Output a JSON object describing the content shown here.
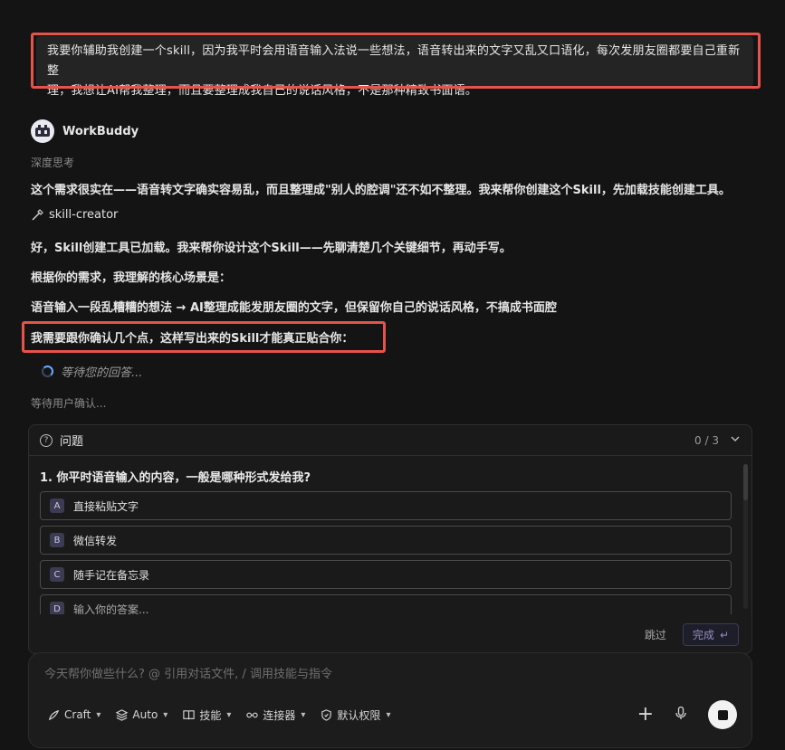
{
  "user_message": {
    "line1": "我要你辅助我创建一个skill，因为我平时会用语音输入法说一些想法，语音转出来的文字又乱又口语化，每次发朋友圈都要自己重新整",
    "line2": "理，我想让AI帮我整理，而且要整理成我自己的说话风格，不是那种精致书面语。"
  },
  "agent": {
    "name": "WorkBuddy",
    "thinking_label": "深度思考",
    "lines": [
      "这个需求很实在——语音转文字确实容易乱，而且整理成\"别人的腔调\"还不如不整理。我来帮你创建这个Skill，先加载技能创建工具。",
      "好，Skill创建工具已加载。我来帮你设计这个Skill——先聊清楚几个关键细节，再动手写。",
      "根据你的需求，我理解的核心场景是：",
      "语音输入一段乱糟糟的想法 → AI整理成能发朋友圈的文字，但保留你自己的说话风格，不搞成书面腔",
      "我需要跟你确认几个点，这样写出来的Skill才能真正贴合你："
    ],
    "skill_tool": "skill-creator",
    "waiting_answer": "等待您的回答...",
    "waiting_confirm": "等待用户确认..."
  },
  "question_card": {
    "title": "问题",
    "count": "0 / 3",
    "question": "1. 你平时语音输入的内容，一般是哪种形式发给我?",
    "options": [
      {
        "key": "A",
        "label": "直接粘贴文字"
      },
      {
        "key": "B",
        "label": "微信转发"
      },
      {
        "key": "C",
        "label": "随手记在备忘录"
      },
      {
        "key": "D",
        "label": "输入你的答案..."
      }
    ],
    "skip_label": "跳过",
    "done_label": "完成",
    "done_glyph": "↵"
  },
  "composer": {
    "placeholder": "今天帮你做些什么? @ 引用对话文件, / 调用技能与指令",
    "tools": {
      "craft": "Craft",
      "auto": "Auto",
      "skills": "技能",
      "connector": "连接器",
      "permission": "默认权限"
    },
    "plus_glyph": "+"
  },
  "colors": {
    "highlight": "#e5534b",
    "background": "#141414",
    "accent": "#6ea8ff"
  }
}
